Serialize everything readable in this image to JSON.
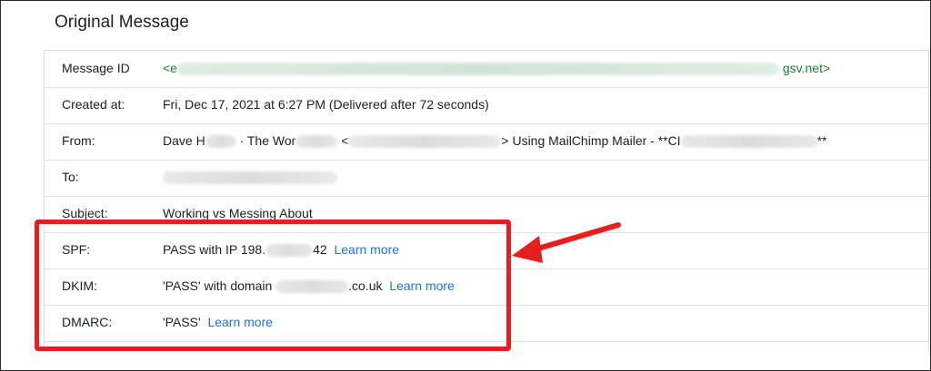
{
  "title": "Original Message",
  "rows": {
    "message_id": {
      "label": "Message ID",
      "value_start": "<e",
      "value_end": "gsv.net>"
    },
    "created": {
      "label": "Created at:",
      "value": "Fri, Dec 17, 2021 at 6:27 PM (Delivered after 72 seconds)"
    },
    "from": {
      "label": "From:",
      "part1": "Dave H",
      "part2": " · The Wor",
      "part3": " <",
      "part4": "> Using MailChimp Mailer - **CI",
      "part5": "**"
    },
    "to": {
      "label": "To:"
    },
    "subject": {
      "label": "Subject:",
      "value": "Working vs Messing About"
    },
    "spf": {
      "label": "SPF:",
      "value_start": "PASS with IP 198.",
      "value_end": "42",
      "link": "Learn more"
    },
    "dkim": {
      "label": "DKIM:",
      "value_start": "'PASS' with domain ",
      "value_end": ".co.uk",
      "link": "Learn more"
    },
    "dmarc": {
      "label": "DMARC:",
      "value": "'PASS'",
      "link": "Learn more"
    }
  },
  "colors": {
    "highlight": "#e81d1d",
    "link": "#1a73e8",
    "id_text": "#188038"
  }
}
